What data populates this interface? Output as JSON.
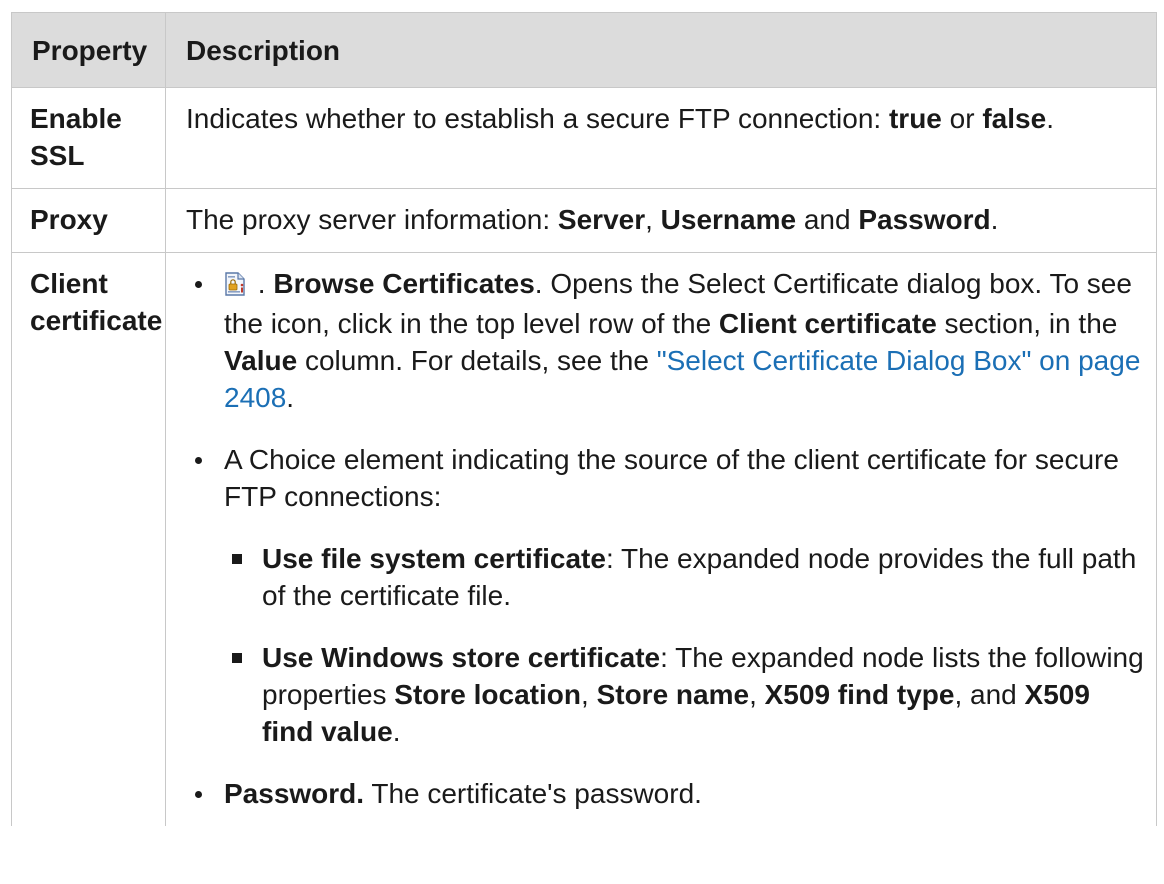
{
  "table": {
    "headers": {
      "property": "Property",
      "description": "Description"
    },
    "rows": [
      {
        "property": "Enable SSL",
        "description": {
          "text_before": "Indicates whether to establish a secure FTP connection: ",
          "bold_1": "true",
          "text_mid": " or ",
          "bold_2": "false",
          "text_after": "."
        }
      },
      {
        "property": "Proxy",
        "description": {
          "text_before": "The proxy server information: ",
          "bold_1": "Server",
          "sep_1": ", ",
          "bold_2": "Username",
          "sep_2": " and ",
          "bold_3": "Password",
          "text_after": "."
        }
      },
      {
        "property": "Client certificate",
        "items": [
          {
            "icon": "browse-certificates-icon",
            "lead": " . ",
            "bold_1": "Browse Certificates",
            "text_1": ". Opens the Select Certificate dialog box. To see the icon, click in the top level row of the ",
            "bold_2": "Client certificate",
            "text_2": " section, in the ",
            "bold_3": "Value",
            "text_3": " column. For details, see the ",
            "link": "\"Select Certificate Dialog Box\" on page 2408",
            "text_4": "."
          },
          {
            "text": "A Choice element indicating the source of the client certificate for secure FTP connections:",
            "subitems": [
              {
                "bold": "Use file system certificate",
                "text": ": The expanded node provides the full path of the certificate file."
              },
              {
                "bold": "Use Windows store certificate",
                "text_1": ": The expanded node lists the following properties ",
                "bold_1": "Store location",
                "sep_1": ", ",
                "bold_2": "Store name",
                "sep_2": ", ",
                "bold_3": "X509 find type",
                "sep_3": ", and ",
                "bold_4": "X509 find value",
                "text_2": "."
              }
            ]
          },
          {
            "bold": "Password.",
            "text": " The certificate's password."
          }
        ]
      }
    ]
  },
  "colors": {
    "header_bg": "#dcdcdc",
    "border": "#c8c8c8",
    "link": "#1b6fb5",
    "text": "#1a1a1a"
  }
}
